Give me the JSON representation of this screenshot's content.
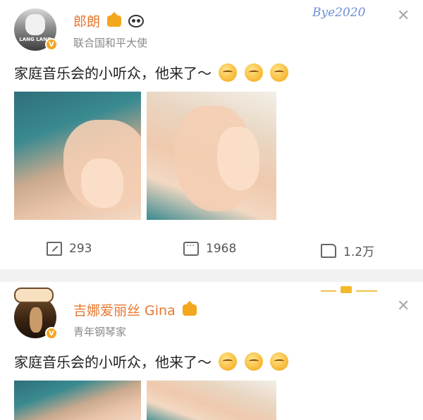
{
  "watermark": "Bye2020",
  "posts": [
    {
      "author": "郎朗",
      "subtitle": "联合国和平大使",
      "content": "家庭音乐会的小听众，他来了～",
      "avatar_label": "LANG LANG",
      "actions": {
        "repost": "293",
        "comment": "1968",
        "like": "1.2万"
      }
    },
    {
      "author": "吉娜爱丽丝 Gina",
      "subtitle": "青年钢琴家",
      "content": "家庭音乐会的小听众，他来了～"
    }
  ],
  "colors": {
    "name": "#e8772e",
    "badge": "#f5a623",
    "divider": "#f2f2f2"
  },
  "icons": [
    "close-icon",
    "repost-icon",
    "comment-icon",
    "like-icon",
    "crown-icon",
    "panda-icon",
    "emoji-icon"
  ]
}
